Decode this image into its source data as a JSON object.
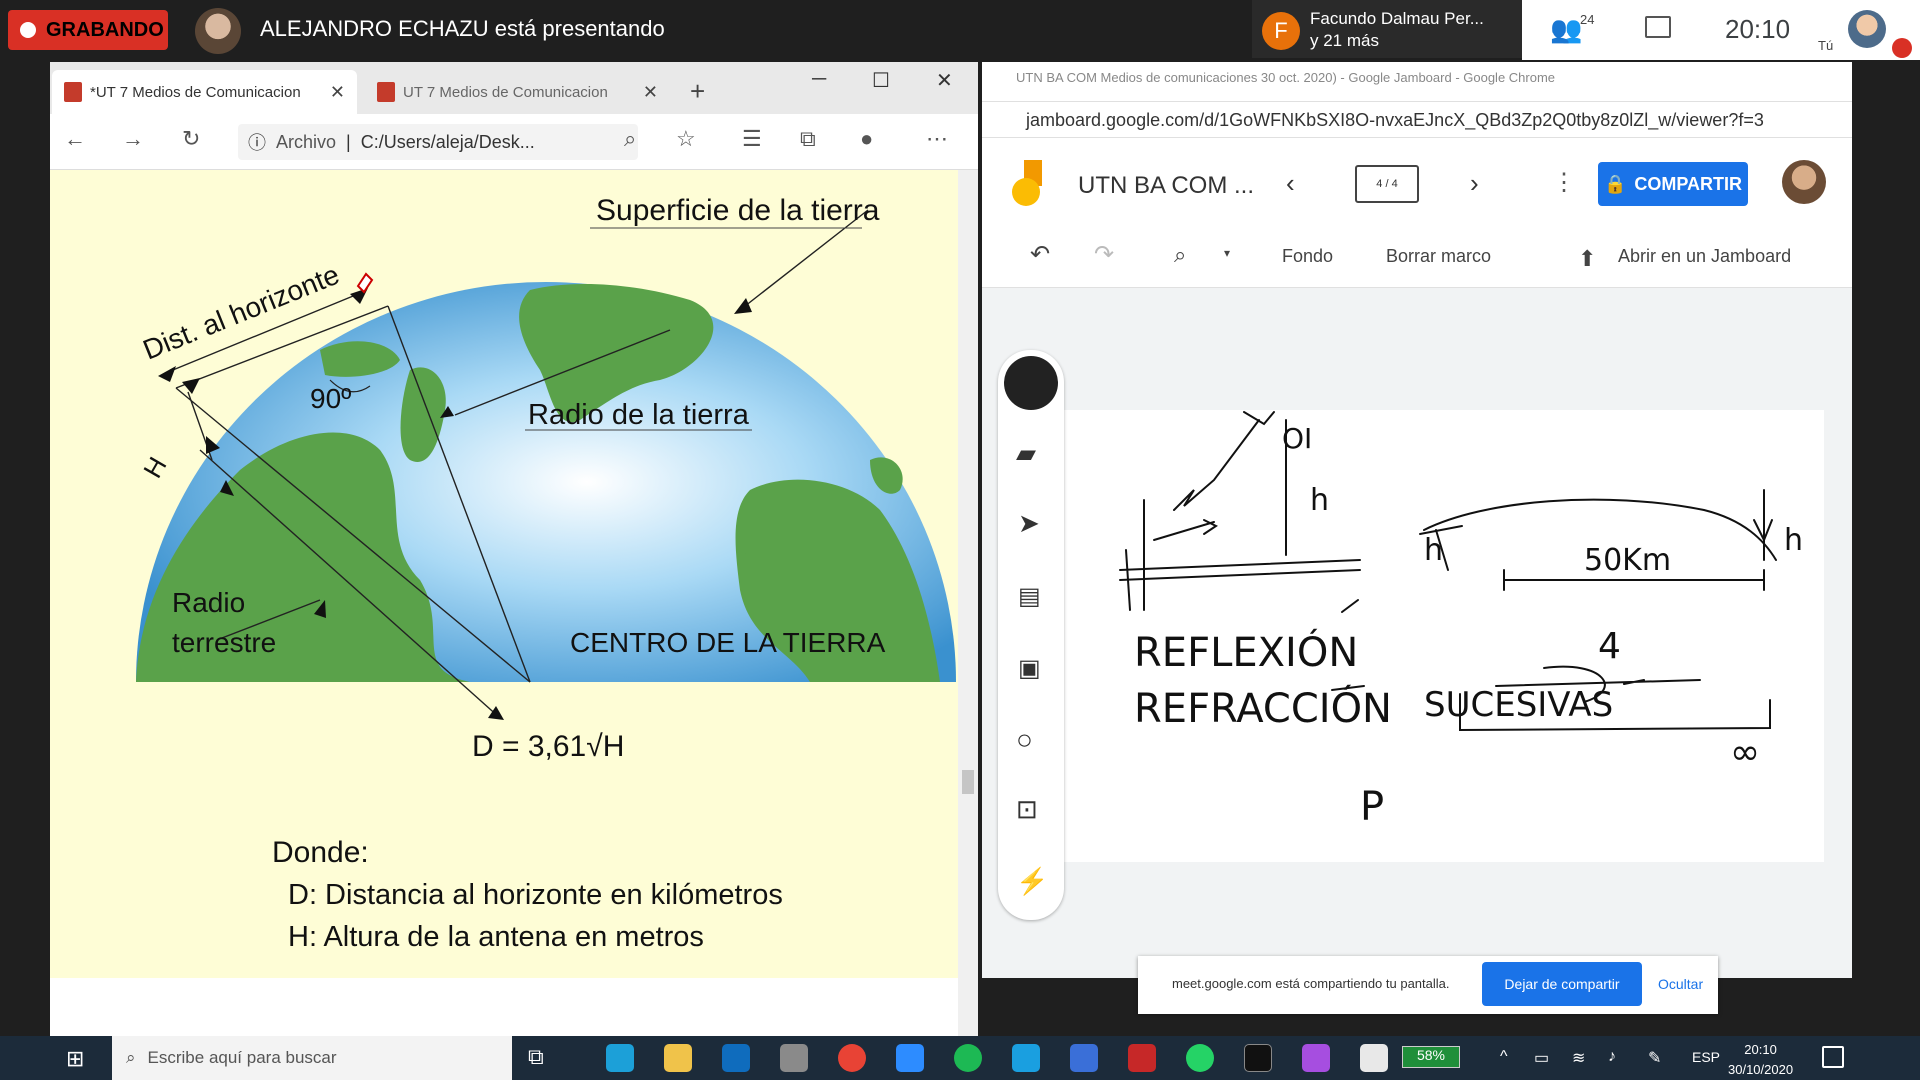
{
  "meet": {
    "rec_label": "GRABANDO",
    "presenter_text": "ALEJANDRO ECHAZU está presentando",
    "participant_initial": "F",
    "participant_name": "Facundo Dalmau Per...",
    "participant_more": "y 21 más",
    "people_count": "24",
    "clock": "20:10",
    "self_label": "Tú"
  },
  "edge": {
    "tabs": [
      {
        "label": "*UT 7 Medios de Comunicacion"
      },
      {
        "label": "UT 7 Medios de Comunicacion"
      }
    ],
    "address_prefix": "Archivo",
    "address": "C:/Users/aleja/Desk..."
  },
  "pdf": {
    "label_surface": "Superficie de la tierra",
    "label_horizon": "Dist. al horizonte",
    "label_angle": "90º",
    "label_h": "H",
    "label_radius": "Radio de la tierra",
    "label_radio1": "Radio",
    "label_radio2": "terrestre",
    "label_center": "CENTRO DE LA TIERRA",
    "formula": "D = 3,61√H",
    "where_title": "Donde:",
    "where_d": "D: Distancia al horizonte en kilómetros",
    "where_h": "H: Altura de la antena en metros"
  },
  "jamboard": {
    "window_title": "UTN BA COM Medios de comunicaciones 30 oct. 2020) - Google Jamboard - Google Chrome",
    "url": "jamboard.google.com/d/1GoWFNKbSXI8O-nvxaEJncX_QBd3Zp2Q0tby8z0lZl_w/viewer?f=3",
    "name": "UTN BA COM ...",
    "frame": "4 / 4",
    "share_label": "COMPARTIR",
    "bg_label": "Fondo",
    "clear_label": "Borrar marco",
    "open_label": "Abrir en un Jamboard",
    "ink": {
      "oi": "OI",
      "h1": "h",
      "h2": "h",
      "h3": "h",
      "km": "50Km",
      "w1": "REFLEXIÓN",
      "w2": "REFRACCIÓN",
      "w3": "SUCESIVAS",
      "p": "P",
      "four": "4",
      "inf": "∞"
    }
  },
  "share_notice": {
    "text": "meet.google.com está compartiendo tu pantalla.",
    "stop": "Dejar de compartir",
    "hide": "Ocultar"
  },
  "taskbar": {
    "search_placeholder": "Escribe aquí para buscar",
    "battery": "58%",
    "lang": "ESP",
    "time": "20:10",
    "date": "30/10/2020"
  },
  "colors": {
    "rec": "#d93025",
    "accent": "#1a73e8",
    "pdf_bg": "#fefdd6",
    "ocean": "#7ac0e8",
    "land": "#5aa24a"
  }
}
